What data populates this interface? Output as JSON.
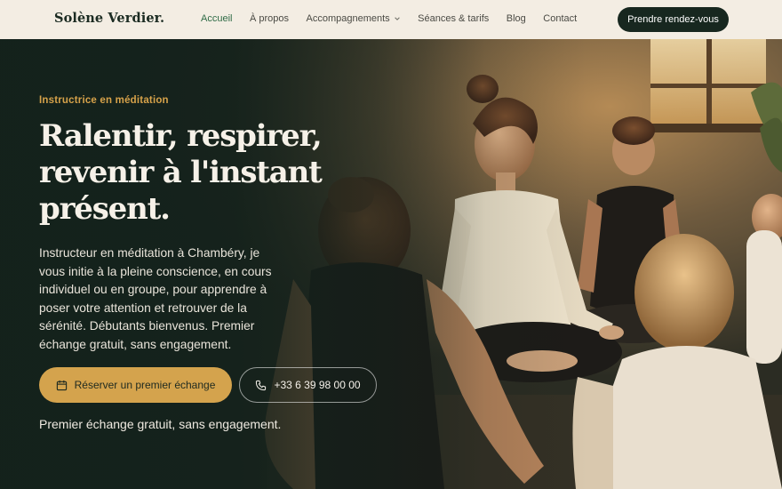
{
  "header": {
    "logo": "Solène Verdier.",
    "nav": [
      {
        "label": "Accueil",
        "active": true
      },
      {
        "label": "À propos",
        "active": false
      },
      {
        "label": "Accompagnements",
        "active": false,
        "dropdown": true
      },
      {
        "label": "Séances & tarifs",
        "active": false
      },
      {
        "label": "Blog",
        "active": false
      },
      {
        "label": "Contact",
        "active": false
      }
    ],
    "cta": "Prendre rendez-vous"
  },
  "hero": {
    "eyebrow": "Instructrice en méditation",
    "title": "Ralentir, respirer, revenir à l'instant présent.",
    "lead": "Instructeur en méditation à Chambéry, je vous initie à la pleine conscience, en cours individuel ou en groupe, pour apprendre à poser votre attention et retrouver de la sérénité. Débutants bienvenus. Premier échange gratuit, sans engagement.",
    "primary_button": {
      "label": "Réserver un premier échange",
      "icon": "calendar-icon"
    },
    "secondary_button": {
      "label": "+33 6 39 98 00 00",
      "icon": "phone-icon"
    },
    "note": "Premier échange gratuit, sans engagement."
  },
  "colors": {
    "nav_bg": "#f3ede3",
    "accent": "#d4a34d",
    "dark": "#17271f",
    "active_link": "#2f6b46"
  }
}
